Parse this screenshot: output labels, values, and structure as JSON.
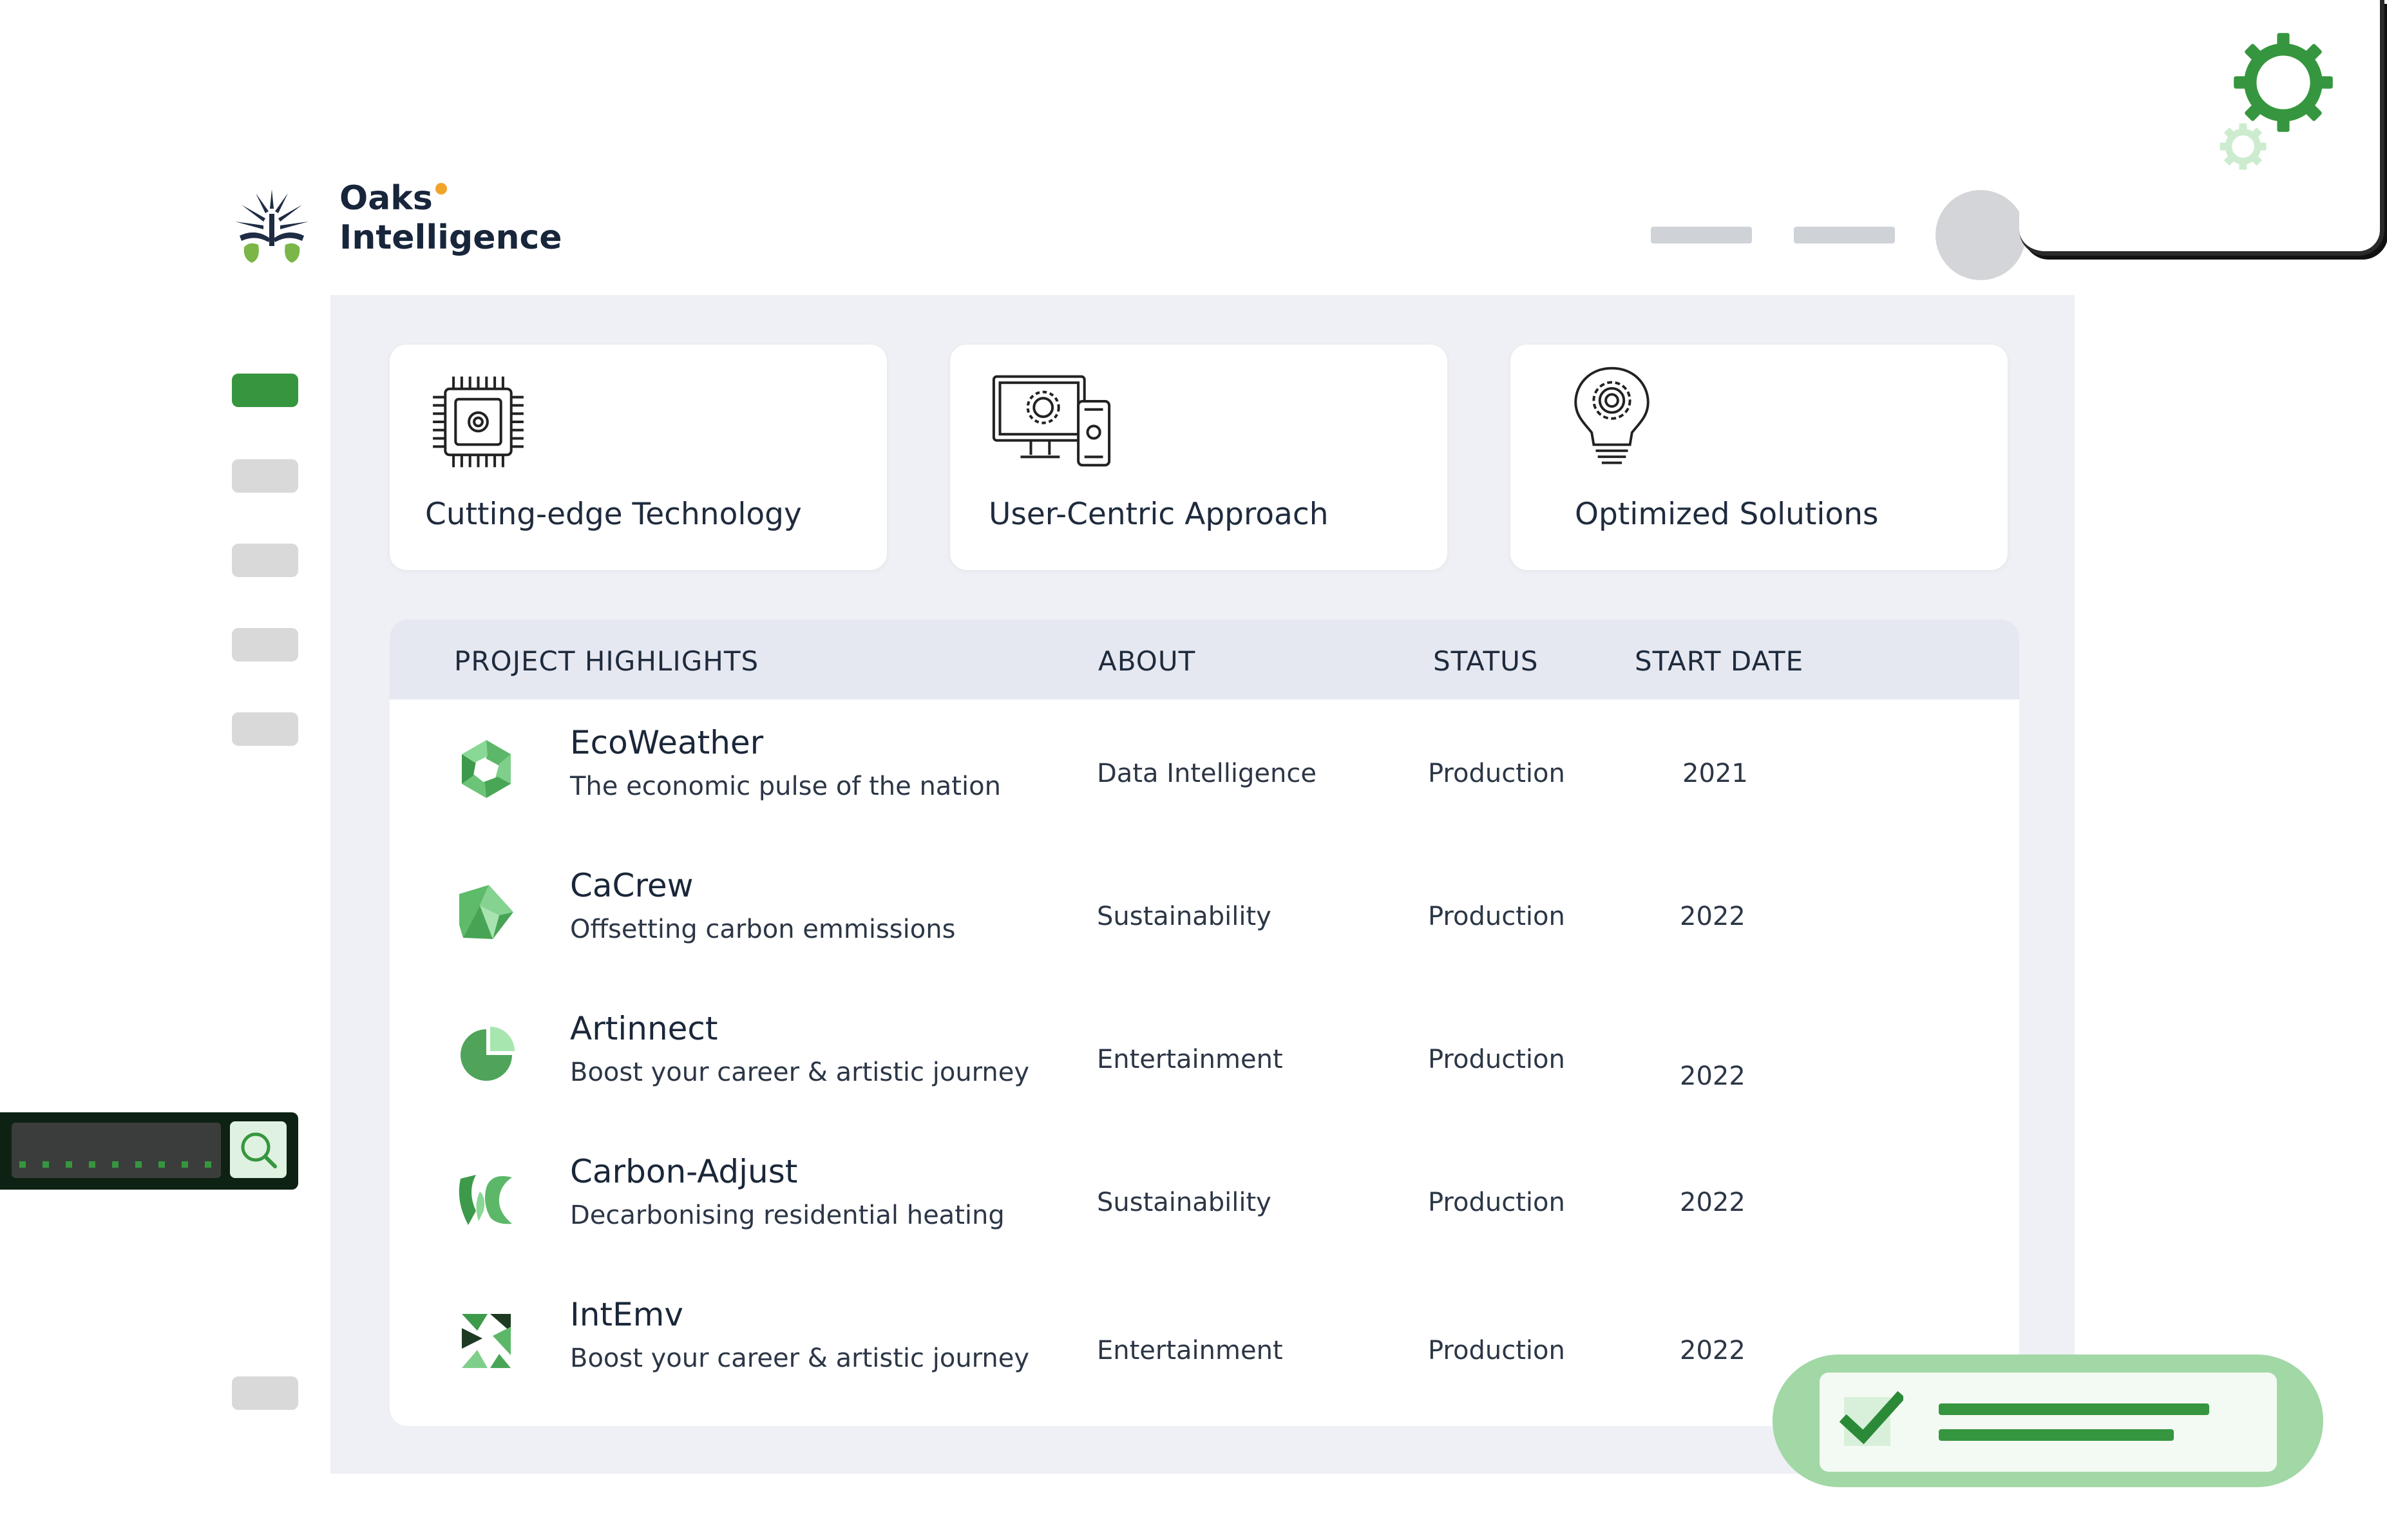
{
  "brand": {
    "line1": "Oaks",
    "line2": "Intelligence"
  },
  "features": [
    {
      "title": "Cutting-edge Technology",
      "icon": "cpu-chip-icon"
    },
    {
      "title": "User-Centric Approach",
      "icon": "devices-settings-icon"
    },
    {
      "title": "Optimized Solutions",
      "icon": "lightbulb-gear-icon"
    }
  ],
  "table": {
    "headers": {
      "project": "PROJECT HIGHLIGHTS",
      "about": "ABOUT",
      "status": "STATUS",
      "start": "START DATE"
    },
    "rows": [
      {
        "name": "EcoWeather",
        "desc": "The economic pulse of the nation",
        "about": "Data Intelligence",
        "status": "Production",
        "start": "2021"
      },
      {
        "name": "CaCrew",
        "desc": "Offsetting carbon emmissions",
        "about": "Sustainability",
        "status": "Production",
        "start": "2022"
      },
      {
        "name": "Artinnect",
        "desc": "Boost your career & artistic journey",
        "about": "Entertainment",
        "status": "Production",
        "start": "2022"
      },
      {
        "name": "Carbon-Adjust",
        "desc": "Decarbonising residential heating",
        "about": "Sustainability",
        "status": "Production",
        "start": "2022"
      },
      {
        "name": "IntEmv",
        "desc": "Boost your career & artistic journey",
        "about": "Entertainment",
        "status": "Production",
        "start": "2022"
      }
    ]
  },
  "colors": {
    "accent": "#36963f",
    "accent_light": "#a2d7a6",
    "navy": "#18263b",
    "panel": "#eef0f5",
    "orange_dot": "#f1a42a"
  }
}
